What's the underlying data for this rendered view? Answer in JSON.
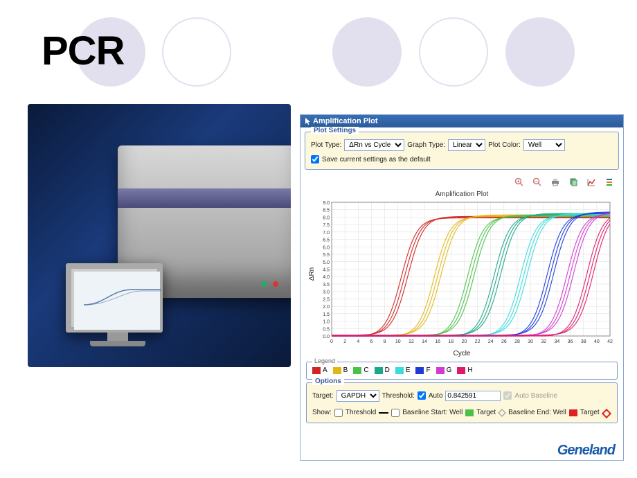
{
  "title": "PCR",
  "panel": {
    "header": "Amplification Plot",
    "plot_settings_label": "Plot Settings",
    "plot_type_label": "Plot Type:",
    "plot_type_value": "ΔRn vs Cycle",
    "graph_type_label": "Graph Type:",
    "graph_type_value": "Linear",
    "plot_color_label": "Plot Color:",
    "plot_color_value": "Well",
    "save_default_label": "Save current settings as the default",
    "toolbar": {
      "zoom_in": "zoom-in",
      "zoom_out": "zoom-out",
      "print": "print",
      "copy": "copy",
      "chart": "chart",
      "list": "list"
    },
    "chart_title": "Amplification Plot",
    "ylabel": "ΔRn",
    "xlabel": "Cycle",
    "legend_label": "Legend",
    "legend_items": [
      {
        "label": "A",
        "color": "#d22222"
      },
      {
        "label": "B",
        "color": "#e0b814"
      },
      {
        "label": "C",
        "color": "#4ac24a"
      },
      {
        "label": "D",
        "color": "#1aa88a"
      },
      {
        "label": "E",
        "color": "#3adcdc"
      },
      {
        "label": "F",
        "color": "#1a3adc"
      },
      {
        "label": "G",
        "color": "#d23ad2"
      },
      {
        "label": "H",
        "color": "#e01a68"
      }
    ],
    "options_label": "Options",
    "target_label": "Target:",
    "target_value": "GAPDH",
    "threshold_label": "Threshold:",
    "auto_label": "Auto",
    "threshold_value": "0.842591",
    "auto_baseline_label": "Auto Baseline",
    "show_label": "Show:",
    "show_threshold": "Threshold",
    "show_baseline_start": "Baseline Start: Well",
    "show_target1": "Target",
    "show_baseline_end": "Baseline End: Well",
    "show_target2": "Target"
  },
  "brand": "Geneland",
  "chart_data": {
    "type": "line",
    "title": "Amplification Plot",
    "xlabel": "Cycle",
    "ylabel": "ΔRn",
    "xlim": [
      0,
      42
    ],
    "ylim": [
      0,
      9
    ],
    "xticks": [
      0,
      2,
      4,
      6,
      8,
      10,
      12,
      14,
      16,
      18,
      20,
      22,
      24,
      26,
      28,
      30,
      32,
      34,
      36,
      38,
      40,
      42
    ],
    "yticks": [
      0.0,
      0.5,
      1.0,
      1.5,
      2.0,
      2.5,
      3.0,
      3.5,
      4.0,
      4.5,
      5.0,
      5.5,
      6.0,
      6.5,
      7.0,
      7.5,
      8.0,
      8.5,
      9.0
    ],
    "series": [
      {
        "name": "A",
        "color": "#d22222",
        "midpoint": 11,
        "plateau": 8.0
      },
      {
        "name": "B",
        "color": "#e0b814",
        "midpoint": 16,
        "plateau": 8.1
      },
      {
        "name": "C",
        "color": "#4ac24a",
        "midpoint": 21,
        "plateau": 8.1
      },
      {
        "name": "D",
        "color": "#1aa88a",
        "midpoint": 25,
        "plateau": 8.2
      },
      {
        "name": "E",
        "color": "#3adcdc",
        "midpoint": 29,
        "plateau": 8.2
      },
      {
        "name": "F",
        "color": "#1a3adc",
        "midpoint": 33,
        "plateau": 8.3
      },
      {
        "name": "G",
        "color": "#d23ad2",
        "midpoint": 36,
        "plateau": 8.3
      },
      {
        "name": "H",
        "color": "#e01a68",
        "midpoint": 39,
        "plateau": 8.4
      }
    ],
    "note": "Each series is a sigmoid amplification curve rising from ~0 to its plateau around the listed midpoint cycle; approx 3 replicate traces per series."
  }
}
